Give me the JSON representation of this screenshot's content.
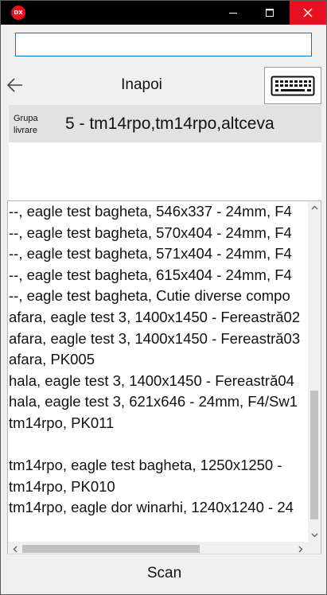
{
  "titlebar": {
    "app_icon_text": "DX",
    "minimize_icon": "minimize-icon",
    "maximize_icon": "maximize-icon",
    "close_icon": "close-icon"
  },
  "search": {
    "value": "",
    "placeholder": ""
  },
  "nav": {
    "back_icon": "arrow-left-icon",
    "back_label": "Inapoi",
    "keyboard_icon": "keyboard-icon"
  },
  "group": {
    "label": "Grupa livrare",
    "value": "5 - tm14rpo,tm14rpo,altceva"
  },
  "list": {
    "items": [
      "--, eagle test bagheta, 546x337 - 24mm, F4",
      "--, eagle test bagheta, 570x404 - 24mm, F4",
      "--, eagle test bagheta, 571x404 - 24mm, F4",
      "--, eagle test bagheta, 615x404 - 24mm, F4",
      "--, eagle test bagheta, Cutie diverse compo",
      "afara, eagle test 3, 1400x1450 - Fereastră02",
      "afara, eagle test 3, 1400x1450 - Fereastră03",
      "afara, PK005",
      "hala, eagle test 3, 1400x1450 - Fereastră04",
      "hala, eagle test 3, 621x646 - 24mm, F4/Sw1",
      "tm14rpo, PK011",
      "",
      "tm14rpo, eagle test bagheta, 1250x1250 -",
      "tm14rpo, PK010",
      "tm14rpo, eagle dor winarhi, 1240x1240 - 24"
    ]
  },
  "scan": {
    "label": "Scan"
  },
  "colors": {
    "close_red": "#e81123",
    "focus_blue": "#0078d7",
    "group_bg": "#e2e2e2"
  }
}
